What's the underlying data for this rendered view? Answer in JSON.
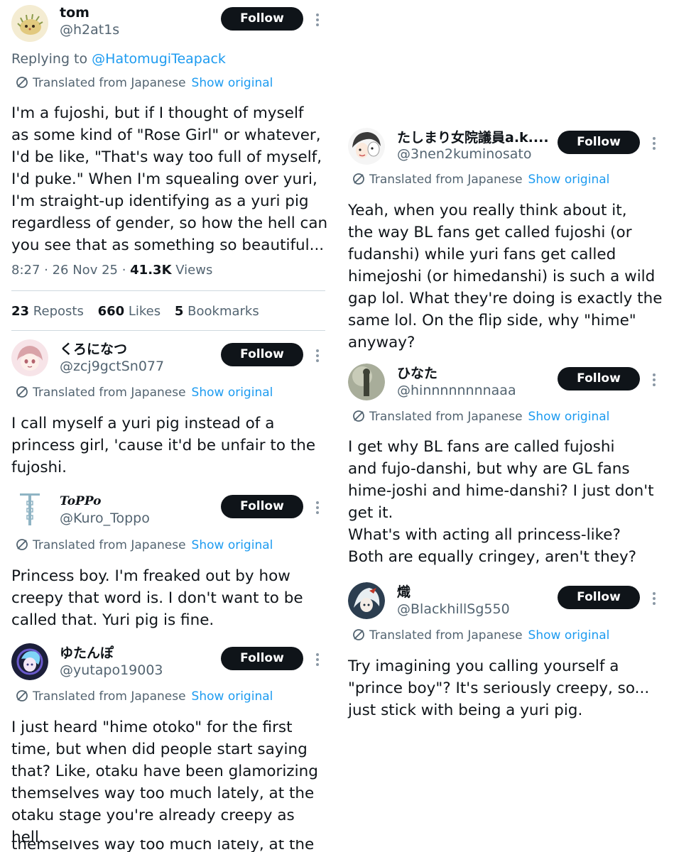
{
  "follow_label": "Follow",
  "translated_label": "Translated from Japanese",
  "show_original_label": "Show original",
  "left_posts": [
    {
      "name": "tom",
      "handle": "@h2at1s",
      "replying_prefix": "Replying to",
      "replying_handle": "@HatomugiTeapack",
      "body": "I'm a fujoshi, but if I thought of myself\nas some kind of \"Rose Girl\" or whatever,\nI'd be like, \"That's way too full of myself,\nI'd puke.\" When I'm squealing over yuri,\nI'm straight-up identifying as a yuri pig\nregardless of gender, so how the hell can\nyou see that as something so beautiful...",
      "time": "8:27 · 26 Nov 25 ·",
      "views_count": "41.3K",
      "views_label": "Views",
      "reposts_count": "23",
      "reposts_label": "Reposts",
      "likes_count": "660",
      "likes_label": "Likes",
      "bookmarks_count": "5",
      "bookmarks_label": "Bookmarks"
    },
    {
      "name": "くろになつ",
      "handle": "@zcj9gctSn077",
      "body": "I call myself a yuri pig instead of a\nprincess girl, 'cause it'd be unfair to the\nfujoshi."
    },
    {
      "name": "ToPPo",
      "handle": "@Kuro_Toppo",
      "body": "Princess boy. I'm freaked out by how\ncreepy that word is. I don't want to be\ncalled that. Yuri pig is fine."
    },
    {
      "name": "ゆたんぽ",
      "handle": "@yutapo19003",
      "body": "I just heard \"hime otoko\" for the first\ntime, but when did people start saying\nthat? Like, otaku have been glamorizing\nthemselves way too much lately, at the\notaku stage you're already creepy as\nhell.",
      "cut_line": "themselves way too much lately, at the"
    }
  ],
  "right_posts": [
    {
      "name": "たしまり女院議員a.k....",
      "handle": "@3nen2kuminosato",
      "body": "Yeah, when you really think about it,\nthe way BL fans get called fujoshi (or\nfudanshi) while yuri fans get called\nhimejoshi (or himedanshi) is such a wild\ngap lol. What they're doing is exactly the\nsame lol. On the flip side, why \"hime\"\nanyway?"
    },
    {
      "name": "ひなた",
      "handle": "@hinnnnnnnnaaa",
      "body": "I get why BL fans are called fujoshi\nand fujo-danshi, but why are GL fans\nhime-joshi and hime-danshi? I just don't\nget it.\nWhat's with acting all princess-like?\nBoth are equally cringey, aren't they?"
    },
    {
      "name": "熾",
      "handle": "@BlackhillSg550",
      "body": "Try imagining you calling yourself a\n\"prince boy\"? It's seriously creepy, so...\njust stick with being a yuri pig."
    }
  ]
}
